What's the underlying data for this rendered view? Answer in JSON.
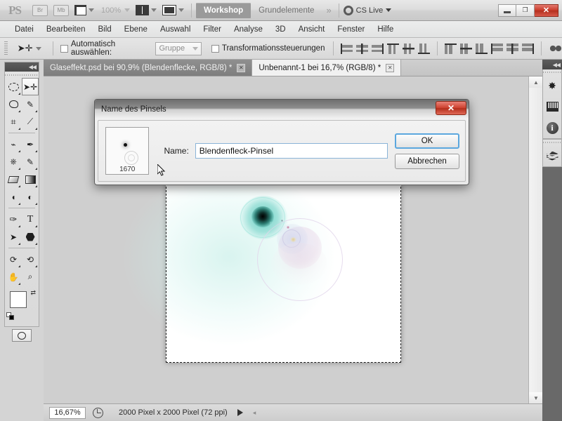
{
  "app": {
    "logo": "PS",
    "bridge_label": "Br",
    "minibridge_label": "Mb",
    "zoom_level": "100%",
    "workspaces": [
      {
        "label": "Workshop",
        "active": true
      },
      {
        "label": "Grundelemente",
        "active": false
      }
    ],
    "more_workspaces_icon": "chevron-double-right-icon",
    "cs_live_label": "CS Live",
    "window_controls": {
      "minimize": "–",
      "restore": "❐",
      "close": "✕"
    }
  },
  "menubar": {
    "items": [
      "Datei",
      "Bearbeiten",
      "Bild",
      "Ebene",
      "Auswahl",
      "Filter",
      "Analyse",
      "3D",
      "Ansicht",
      "Fenster",
      "Hilfe"
    ]
  },
  "options_bar": {
    "tool_icon": "move-tool-icon",
    "auto_select_label": "Automatisch auswählen:",
    "auto_select_checked": false,
    "auto_select_scope": "Gruppe",
    "transform_controls_label": "Transformationssteuerungen",
    "transform_controls_checked": false,
    "align_icons": [
      "align-left-edges-icon",
      "align-horizontal-centers-icon",
      "align-right-edges-icon",
      "align-top-edges-icon",
      "align-vertical-centers-icon",
      "align-bottom-edges-icon",
      "distribute-top-edges-icon",
      "distribute-vertical-centers-icon",
      "distribute-bottom-edges-icon",
      "distribute-left-edges-icon",
      "distribute-horizontal-centers-icon",
      "distribute-right-edges-icon",
      "auto-align-layers-icon"
    ]
  },
  "document_tabs": [
    {
      "title": "Glaseffekt.psd bei 90,9% (Blendenflecke, RGB/8) *",
      "active": false,
      "close_icon": "close-icon"
    },
    {
      "title": "Unbenannt-1 bei 16,7% (RGB/8) *",
      "active": true,
      "close_icon": "close-icon"
    }
  ],
  "toolbox": {
    "collapse_icon": "collapse-left-icon",
    "tools": [
      {
        "name": "marquee-tool",
        "glyph": "▭",
        "selected": false,
        "has_submenu": true
      },
      {
        "name": "move-tool",
        "glyph": "✛",
        "selected": true,
        "has_submenu": false
      },
      {
        "name": "lasso-tool",
        "glyph": "◯",
        "selected": false,
        "has_submenu": true
      },
      {
        "name": "quick-selection-tool",
        "glyph": "✎",
        "selected": false,
        "has_submenu": true
      },
      {
        "name": "crop-tool",
        "glyph": "✂",
        "selected": false,
        "has_submenu": true
      },
      {
        "name": "eyedropper-tool",
        "glyph": "💉",
        "selected": false,
        "has_submenu": true
      },
      {
        "name": "healing-brush-tool",
        "glyph": "⚕",
        "selected": false,
        "has_submenu": true
      },
      {
        "name": "brush-tool",
        "glyph": "🖌",
        "selected": false,
        "has_submenu": true
      },
      {
        "name": "clone-stamp-tool",
        "glyph": "⎈",
        "selected": false,
        "has_submenu": true
      },
      {
        "name": "history-brush-tool",
        "glyph": "✒",
        "selected": false,
        "has_submenu": true
      },
      {
        "name": "eraser-tool",
        "glyph": "▱",
        "selected": false,
        "has_submenu": true
      },
      {
        "name": "gradient-tool",
        "glyph": "▤",
        "selected": false,
        "has_submenu": true
      },
      {
        "name": "blur-tool",
        "glyph": "💧",
        "selected": false,
        "has_submenu": true
      },
      {
        "name": "dodge-tool",
        "glyph": "◔",
        "selected": false,
        "has_submenu": true
      },
      {
        "name": "pen-tool",
        "glyph": "✐",
        "selected": false,
        "has_submenu": true
      },
      {
        "name": "type-tool",
        "glyph": "T",
        "selected": false,
        "has_submenu": true
      },
      {
        "name": "path-selection-tool",
        "glyph": "➤",
        "selected": false,
        "has_submenu": true
      },
      {
        "name": "shape-tool",
        "glyph": "⬡",
        "selected": false,
        "has_submenu": true
      },
      {
        "name": "rotate-view-tool",
        "glyph": "⟳",
        "selected": false,
        "has_submenu": true
      },
      {
        "name": "three-d-orbit-tool",
        "glyph": "⟲",
        "selected": false,
        "has_submenu": true
      },
      {
        "name": "hand-tool",
        "glyph": "✋",
        "selected": false,
        "has_submenu": true
      },
      {
        "name": "zoom-tool",
        "glyph": "🔍",
        "selected": false,
        "has_submenu": false
      }
    ],
    "foreground_color": "#ffffff",
    "background_color": "#000000",
    "swap_colors_icon": "swap-colors-icon",
    "default_colors_icon": "default-colors-icon",
    "quick_mask_icon": "quick-mask-icon"
  },
  "right_dock": {
    "collapse_icon": "collapse-right-icon",
    "panels": [
      {
        "name": "navigator-panel-icon",
        "glyph": "✺"
      },
      {
        "name": "histogram-panel-icon",
        "glyph": "▮"
      },
      {
        "name": "info-panel-icon",
        "glyph": "i"
      },
      {
        "name": "layers-panel-icon",
        "glyph": "◈"
      }
    ]
  },
  "canvas": {
    "document_name": "Unbenannt-1",
    "background_color": "#cfcfcf",
    "paper_color": "#ffffff",
    "selection": "full-canvas-marching-ants",
    "artwork": {
      "name": "lens-flare",
      "teal_core_color": "#0d1a18",
      "teal_glow_color": "#7fd8cf",
      "lavender_color": "#d9c9e0",
      "ring_color": "#e8e2ee"
    }
  },
  "status_bar": {
    "zoom_value": "16,67%",
    "preview_icon": "preview-clock-icon",
    "doc_info": "2000 Pixel x 2000 Pixel (72 ppi)",
    "menu_arrow_icon": "play-triangle-icon"
  },
  "dialog": {
    "title": "Name des Pinsels",
    "close_icon": "close-icon",
    "brush_preview": {
      "size_label": "1670",
      "name": "brush-preview-thumbnail"
    },
    "name_label": "Name:",
    "name_value": "Blendenfleck-Pinsel",
    "name_placeholder": "Name",
    "ok_label": "OK",
    "cancel_label": "Abbrechen",
    "accent_color": "#5ba7de"
  }
}
